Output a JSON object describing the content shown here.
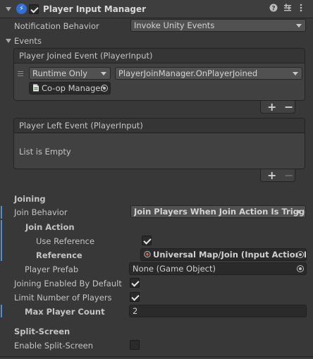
{
  "component": {
    "title": "Player Input Manager",
    "enabled": true,
    "icon": "player-input-manager-icon"
  },
  "notification_behavior": {
    "label": "Notification Behavior",
    "value": "Invoke Unity Events"
  },
  "events": {
    "label": "Events",
    "player_joined": {
      "header": "Player Joined Event (PlayerInput)",
      "runtime": "Runtime Only",
      "function": "PlayerJoinManager.OnPlayerJoined",
      "target": "Co-op Manager"
    },
    "player_left": {
      "header": "Player Left Event (PlayerInput)",
      "empty_text": "List is Empty"
    },
    "add_label": "+",
    "remove_label": "−"
  },
  "joining": {
    "section_label": "Joining",
    "behavior_label": "Join Behavior",
    "behavior_value": "Join Players When Join Action Is Triggered",
    "join_action_label": "Join Action",
    "use_reference_label": "Use Reference",
    "use_reference": true,
    "reference_label": "Reference",
    "reference_value": "Universal Map/Join (Input Action Reference)",
    "player_prefab_label": "Player Prefab",
    "player_prefab_value": "None (Game Object)",
    "joining_enabled_label": "Joining Enabled By Default",
    "joining_enabled": true,
    "limit_players_label": "Limit Number of Players",
    "limit_players": true,
    "max_count_label": "Max Player Count",
    "max_count_value": "2"
  },
  "split_screen": {
    "section_label": "Split-Screen",
    "enable_label": "Enable Split-Screen",
    "enabled": false
  },
  "colors": {
    "background": "#383838",
    "accent": "#4a90d9",
    "component_icon": "#2f6fd6"
  }
}
